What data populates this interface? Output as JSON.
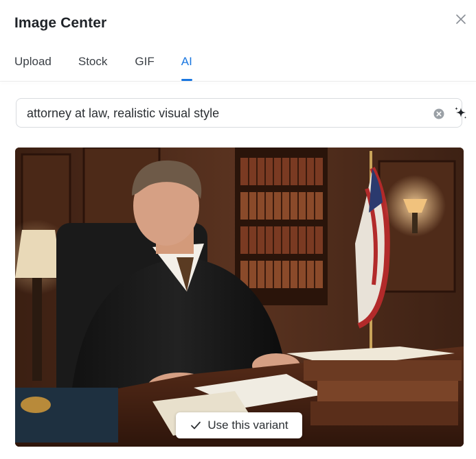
{
  "dialog": {
    "title": "Image Center",
    "close_icon": "close-icon"
  },
  "tabs": [
    {
      "label": "Upload",
      "active": false
    },
    {
      "label": "Stock",
      "active": false
    },
    {
      "label": "GIF",
      "active": false
    },
    {
      "label": "AI",
      "active": true
    }
  ],
  "search": {
    "value": "attorney at law, realistic visual style",
    "clear_icon": "clear-icon",
    "generate_icon": "sparkle-icon"
  },
  "result": {
    "image_subject": "judge-in-robe-at-desk",
    "action_label": "Use this variant",
    "action_icon": "check-icon"
  },
  "colors": {
    "accent": "#1976e0",
    "text": "#1f2328",
    "border": "#d8dbdf"
  }
}
